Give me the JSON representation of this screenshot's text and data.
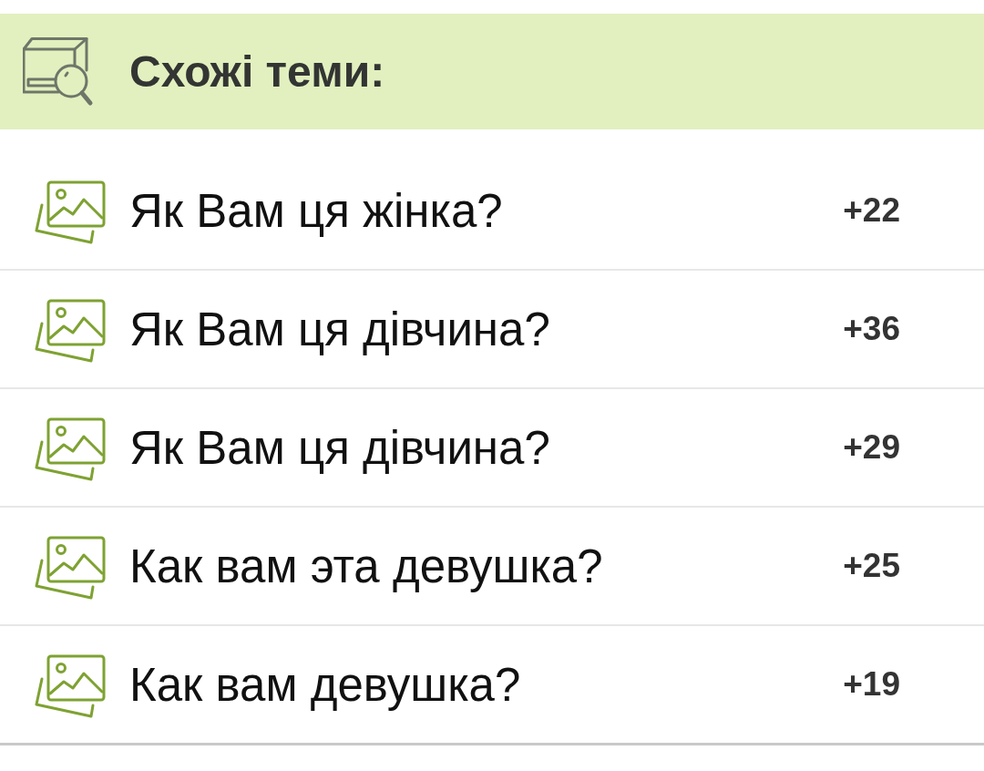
{
  "header": {
    "title": "Схожі теми:"
  },
  "topics": [
    {
      "title": "Як Вам ця жінка?",
      "count": "+22"
    },
    {
      "title": "Як Вам ця дівчина?",
      "count": "+36"
    },
    {
      "title": "Як Вам ця дівчина?",
      "count": "+29"
    },
    {
      "title": "Как вам эта девушка?",
      "count": "+25"
    },
    {
      "title": "Как вам девушка?",
      "count": "+19"
    }
  ]
}
